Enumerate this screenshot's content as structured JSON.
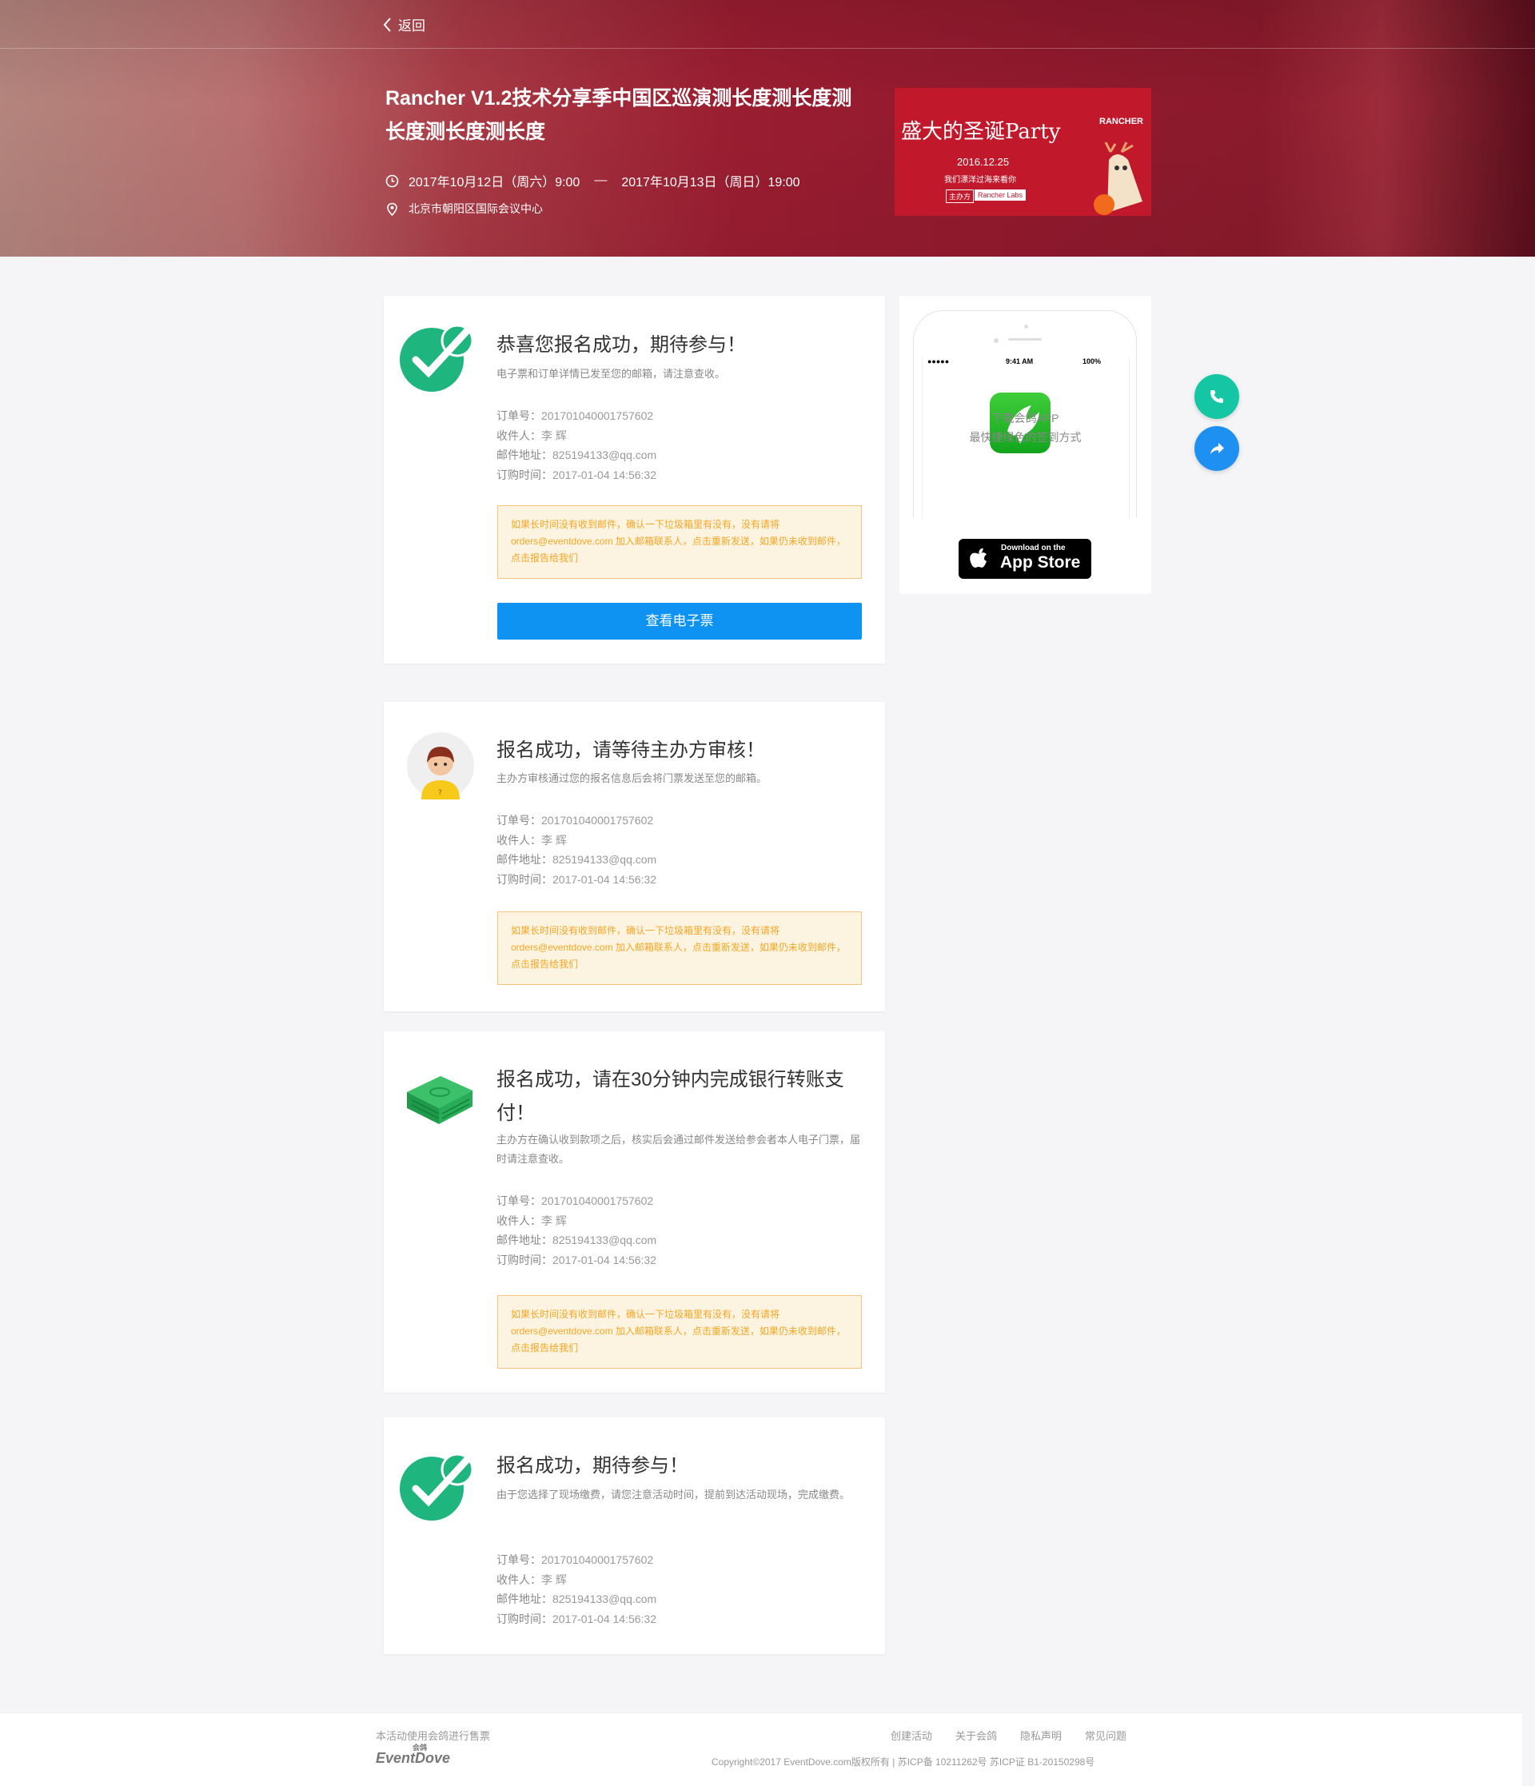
{
  "nav": {
    "back_label": "返回"
  },
  "event": {
    "title": "Rancher V1.2技术分享季中国区巡演测长度测长度测长度测长度测长度",
    "start_time": "2017年10月12日（周六）9:00",
    "separator": "—",
    "end_time": "2017年10月13日（周日）19:00",
    "location": "北京市朝阳区国际会议中心"
  },
  "poster": {
    "title": "盛大的圣诞Party",
    "date": "2016.12.25",
    "slogan": "我们漂洋过海来看你",
    "organizer_label": "主办方",
    "organizer": "Rancher Labs",
    "brand": "RANCHER"
  },
  "cards": [
    {
      "title": "恭喜您报名成功，期待参与！",
      "subtitle": "电子票和订单详情已发至您的邮箱，请注意查收。",
      "order_label": "订单号：",
      "order_no": "201701040001757602",
      "recipient_label": "收件人：",
      "recipient": "李 辉",
      "email_label": "邮件地址：",
      "email": "825194133@qq.com",
      "time_label": "订购时间：",
      "time": "2017-01-04 14:56:32",
      "notice": "如果长时间没有收到邮件，确认一下垃圾箱里有没有，没有请将orders@eventdove.com 加入邮箱联系人，点击重新发送，如果仍未收到邮件，点击报告给我们",
      "button": "查看电子票"
    },
    {
      "title": "报名成功，请等待主办方审核！",
      "subtitle": "主办方审核通过您的报名信息后会将门票发送至您的邮箱。",
      "order_label": "订单号：",
      "order_no": "201701040001757602",
      "recipient_label": "收件人：",
      "recipient": "李 辉",
      "email_label": "邮件地址：",
      "email": "825194133@qq.com",
      "time_label": "订购时间：",
      "time": "2017-01-04 14:56:32",
      "notice": "如果长时间没有收到邮件，确认一下垃圾箱里有没有，没有请将orders@eventdove.com 加入邮箱联系人，点击重新发送，如果仍未收到邮件，点击报告给我们"
    },
    {
      "title": "报名成功，请在30分钟内完成银行转账支付！",
      "subtitle": "主办方在确认收到款项之后，核实后会通过邮件发送给参会者本人电子门票，届时请注意查收。",
      "order_label": "订单号：",
      "order_no": "201701040001757602",
      "recipient_label": "收件人：",
      "recipient": "李 辉",
      "email_label": "邮件地址：",
      "email": "825194133@qq.com",
      "time_label": "订购时间：",
      "time": "2017-01-04 14:56:32",
      "notice": "如果长时间没有收到邮件，确认一下垃圾箱里有没有，没有请将orders@eventdove.com 加入邮箱联系人，点击重新发送，如果仍未收到邮件，点击报告给我们"
    },
    {
      "title": "报名成功，期待参与！",
      "subtitle": "由于您选择了现场缴费，请您注意活动时间，提前到达活动现场，完成缴费。",
      "order_label": "订单号：",
      "order_no": "201701040001757602",
      "recipient_label": "收件人：",
      "recipient": "李 辉",
      "email_label": "邮件地址：",
      "email": "825194133@qq.com",
      "time_label": "订购时间：",
      "time": "2017-01-04 14:56:32"
    }
  ],
  "app": {
    "status_left": "●●●●● ",
    "status_time": "9:41 AM",
    "status_battery": "100%",
    "download_title": "下载会鸽APP",
    "download_sub": "最快捷绿色的签到方式",
    "store_small": "Download on the",
    "store_big": "App Store"
  },
  "footer": {
    "powered": "本活动使用会鸽进行售票",
    "logo_text": "EventDove",
    "logo_cn": "会鸽",
    "links": [
      "创建活动",
      "关于会鸽",
      "隐私声明",
      "常见问题"
    ],
    "copyright": "Copyright©2017 EventDove.com版权所有  |  苏ICP备 10211262号  苏ICP证 B1-20150298号"
  },
  "colors": {
    "header": "#92192e",
    "primary_button": "#0e93f3",
    "notice_text": "#f5a623",
    "success_green": "#1fb57f",
    "fab_phone": "#14c6a3",
    "fab_share": "#1e90f2"
  }
}
